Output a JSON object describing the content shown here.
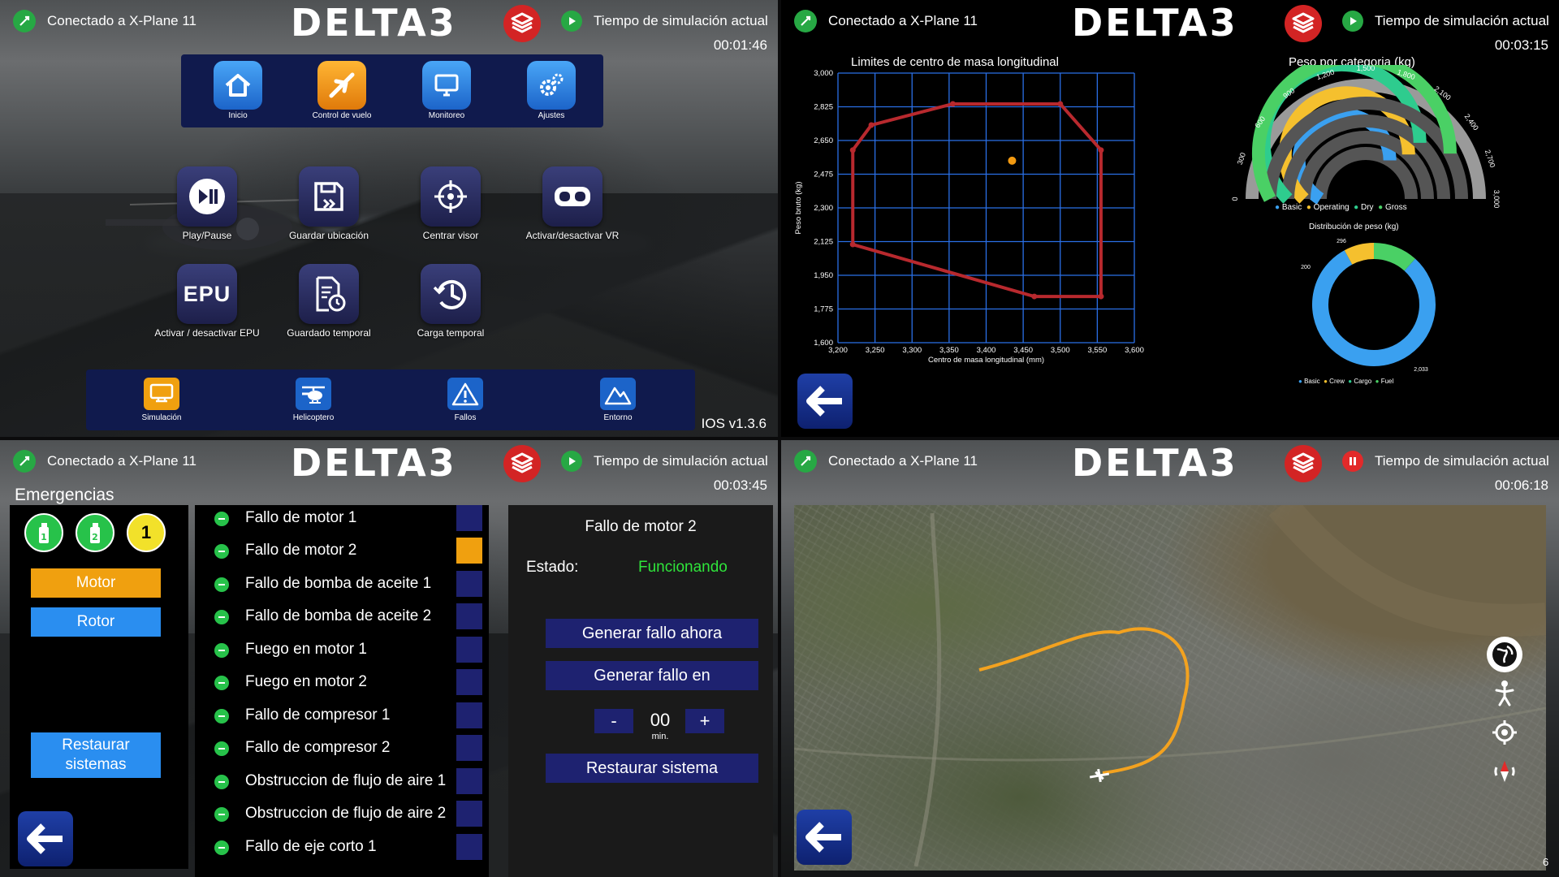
{
  "header": {
    "connection": "Conectado a X-Plane 11",
    "logo": "DELTA3",
    "sim_time_label": "Tiempo de simulación actual"
  },
  "q1": {
    "sim_time": "00:01:46",
    "menu": [
      "Inicio",
      "Control de vuelo",
      "Monitoreo",
      "Ajustes"
    ],
    "apps": [
      "Play/Pause",
      "Guardar ubicación",
      "Centrar visor",
      "Activar/desactivar VR",
      "Activar / desactivar EPU",
      "Guardado temporal",
      "Carga temporal"
    ],
    "epu_icon_text": "EPU",
    "bottom": [
      "Simulación",
      "Helicoptero",
      "Fallos",
      "Entorno"
    ],
    "version": "IOS v1.3.6"
  },
  "q2": {
    "sim_time": "00:03:15",
    "cg_chart_title": "Limites de centro de masa longitudinal",
    "cg_ylabel": "Peso bruto (kg)",
    "cg_xlabel": "Centro de masa longitudinal (mm)",
    "cg_yticks": [
      "3,000",
      "2,825",
      "2,650",
      "2,475",
      "2,300",
      "2,125",
      "1,950",
      "1,775",
      "1,600"
    ],
    "cg_xticks": [
      "3,200",
      "3,250",
      "3,300",
      "3,350",
      "3,400",
      "3,450",
      "3,500",
      "3,550",
      "3,600"
    ],
    "gauge_title": "Peso por categoria (kg)",
    "gauge_ticks": [
      "0",
      "300",
      "600",
      "900",
      "1,200",
      "1,500",
      "1,800",
      "2,100",
      "2,400",
      "2,700",
      "3,000"
    ],
    "gauge_legend": [
      "Basic",
      "Operating",
      "Dry",
      "Gross"
    ],
    "donut_title": "Distribución de peso (kg)",
    "donut_labels": [
      "296",
      "200",
      "2,033"
    ],
    "donut_legend": [
      "Basic",
      "Crew",
      "Cargo",
      "Fuel"
    ]
  },
  "q3": {
    "sim_time": "00:03:45",
    "title": "Emergencias",
    "extinguishers": [
      "1",
      "2",
      "1"
    ],
    "categories": [
      "Motor",
      "Rotor"
    ],
    "restore_all": "Restaurar sistemas",
    "faults": [
      "Fallo de motor 1",
      "Fallo de motor 2",
      "Fallo de bomba de aceite 1",
      "Fallo de bomba de aceite 2",
      "Fuego en motor 1",
      "Fuego en motor 2",
      "Fallo de compresor 1",
      "Fallo de compresor 2",
      "Obstruccion de flujo de aire 1",
      "Obstruccion de flujo de aire 2",
      "Fallo de eje corto 1"
    ],
    "selected_title": "Fallo de motor 2",
    "state_label": "Estado:",
    "state_value": "Funcionando",
    "btn_now": "Generar fallo ahora",
    "btn_in": "Generar fallo en",
    "minus": "-",
    "plus": "+",
    "minutes_value": "00",
    "minutes_unit": "min.",
    "btn_restore": "Restaurar sistema"
  },
  "q4": {
    "sim_time": "00:06:18",
    "corner_text": "6"
  },
  "colors": {
    "accent_blue": "#2a6fe6",
    "panel_navy": "#101a4d",
    "button_navy": "#1e2270",
    "orange": "#f0a00f",
    "green": "#27a844",
    "red": "#d32424",
    "track_orange": "#f3a21f",
    "cg_polygon": "#b8292e",
    "cg_point": "#f39a11"
  },
  "chart_data": [
    {
      "type": "line",
      "title": "Limites de centro de masa longitudinal",
      "xlabel": "Centro de masa longitudinal (mm)",
      "ylabel": "Peso bruto (kg)",
      "xlim": [
        3200,
        3600
      ],
      "ylim": [
        1600,
        3000
      ],
      "grid": true,
      "series": [
        {
          "values": [
            [
              3220,
              2600
            ],
            [
              3245,
              2730
            ],
            [
              3355,
              2840
            ],
            [
              3500,
              2840
            ],
            [
              3555,
              2600
            ],
            [
              3555,
              1840
            ],
            [
              3465,
              1840
            ],
            [
              3220,
              2110
            ],
            [
              3220,
              2600
            ]
          ]
        },
        {
          "values": [
            [
              3435,
              2545
            ]
          ]
        }
      ]
    },
    {
      "type": "bar",
      "title": "Peso por categoria (kg)",
      "categories": [
        "Basic",
        "Operating",
        "Dry",
        "Gross"
      ],
      "values": [
        2033,
        2233,
        2233,
        2529
      ],
      "ylim": [
        0,
        3000
      ]
    },
    {
      "type": "pie",
      "title": "Distribución de peso (kg)",
      "categories": [
        "Basic",
        "Crew",
        "Cargo",
        "Fuel"
      ],
      "values": [
        2033,
        200,
        0,
        296
      ]
    }
  ]
}
